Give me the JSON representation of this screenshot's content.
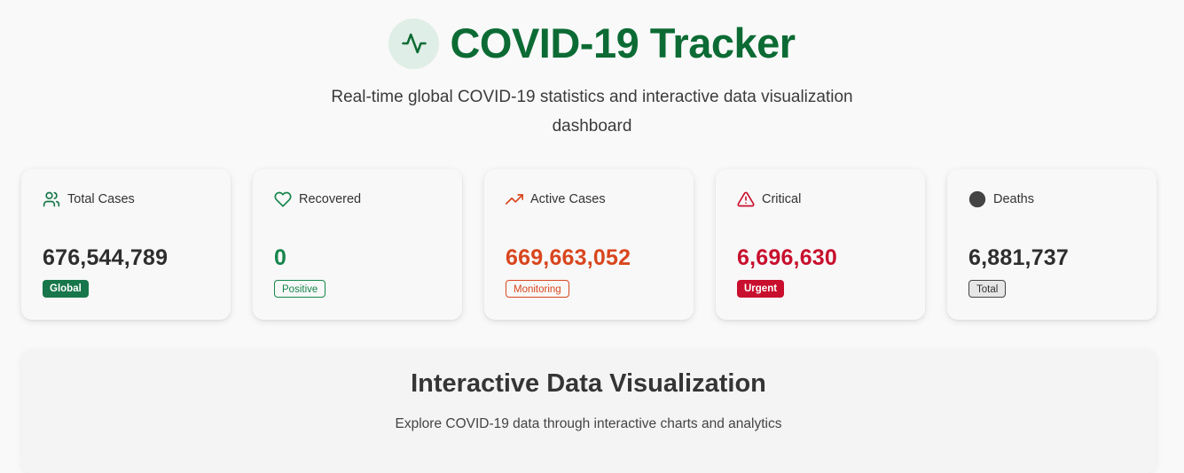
{
  "header": {
    "title": "COVID-19 Tracker",
    "logo_icon": "activity-pulse-icon",
    "subtitle_line1": "Real-time global COVID-19 statistics and interactive data visualization",
    "subtitle_line2": "dashboard"
  },
  "stats": [
    {
      "label": "Total Cases",
      "icon": "users-icon",
      "value": "676,544,789",
      "badge": "Global",
      "value_color": "#2e2e2e",
      "accent": "#17764a"
    },
    {
      "label": "Recovered",
      "icon": "heart-icon",
      "value": "0",
      "badge": "Positive",
      "value_color": "#17864d",
      "accent": "#17864d"
    },
    {
      "label": "Active Cases",
      "icon": "trending-up-icon",
      "value": "669,663,052",
      "badge": "Monitoring",
      "value_color": "#d9461e",
      "accent": "#d9461e"
    },
    {
      "label": "Critical",
      "icon": "alert-triangle-icon",
      "value": "6,696,630",
      "badge": "Urgent",
      "value_color": "#c8102e",
      "accent": "#c8102e"
    },
    {
      "label": "Deaths",
      "icon": "filled-circle-icon",
      "value": "6,881,737",
      "badge": "Total",
      "value_color": "#2e2e2e",
      "accent": "#444444"
    }
  ],
  "visualization": {
    "title": "Interactive Data Visualization",
    "subtitle": "Explore COVID-19 data through interactive charts and analytics"
  }
}
